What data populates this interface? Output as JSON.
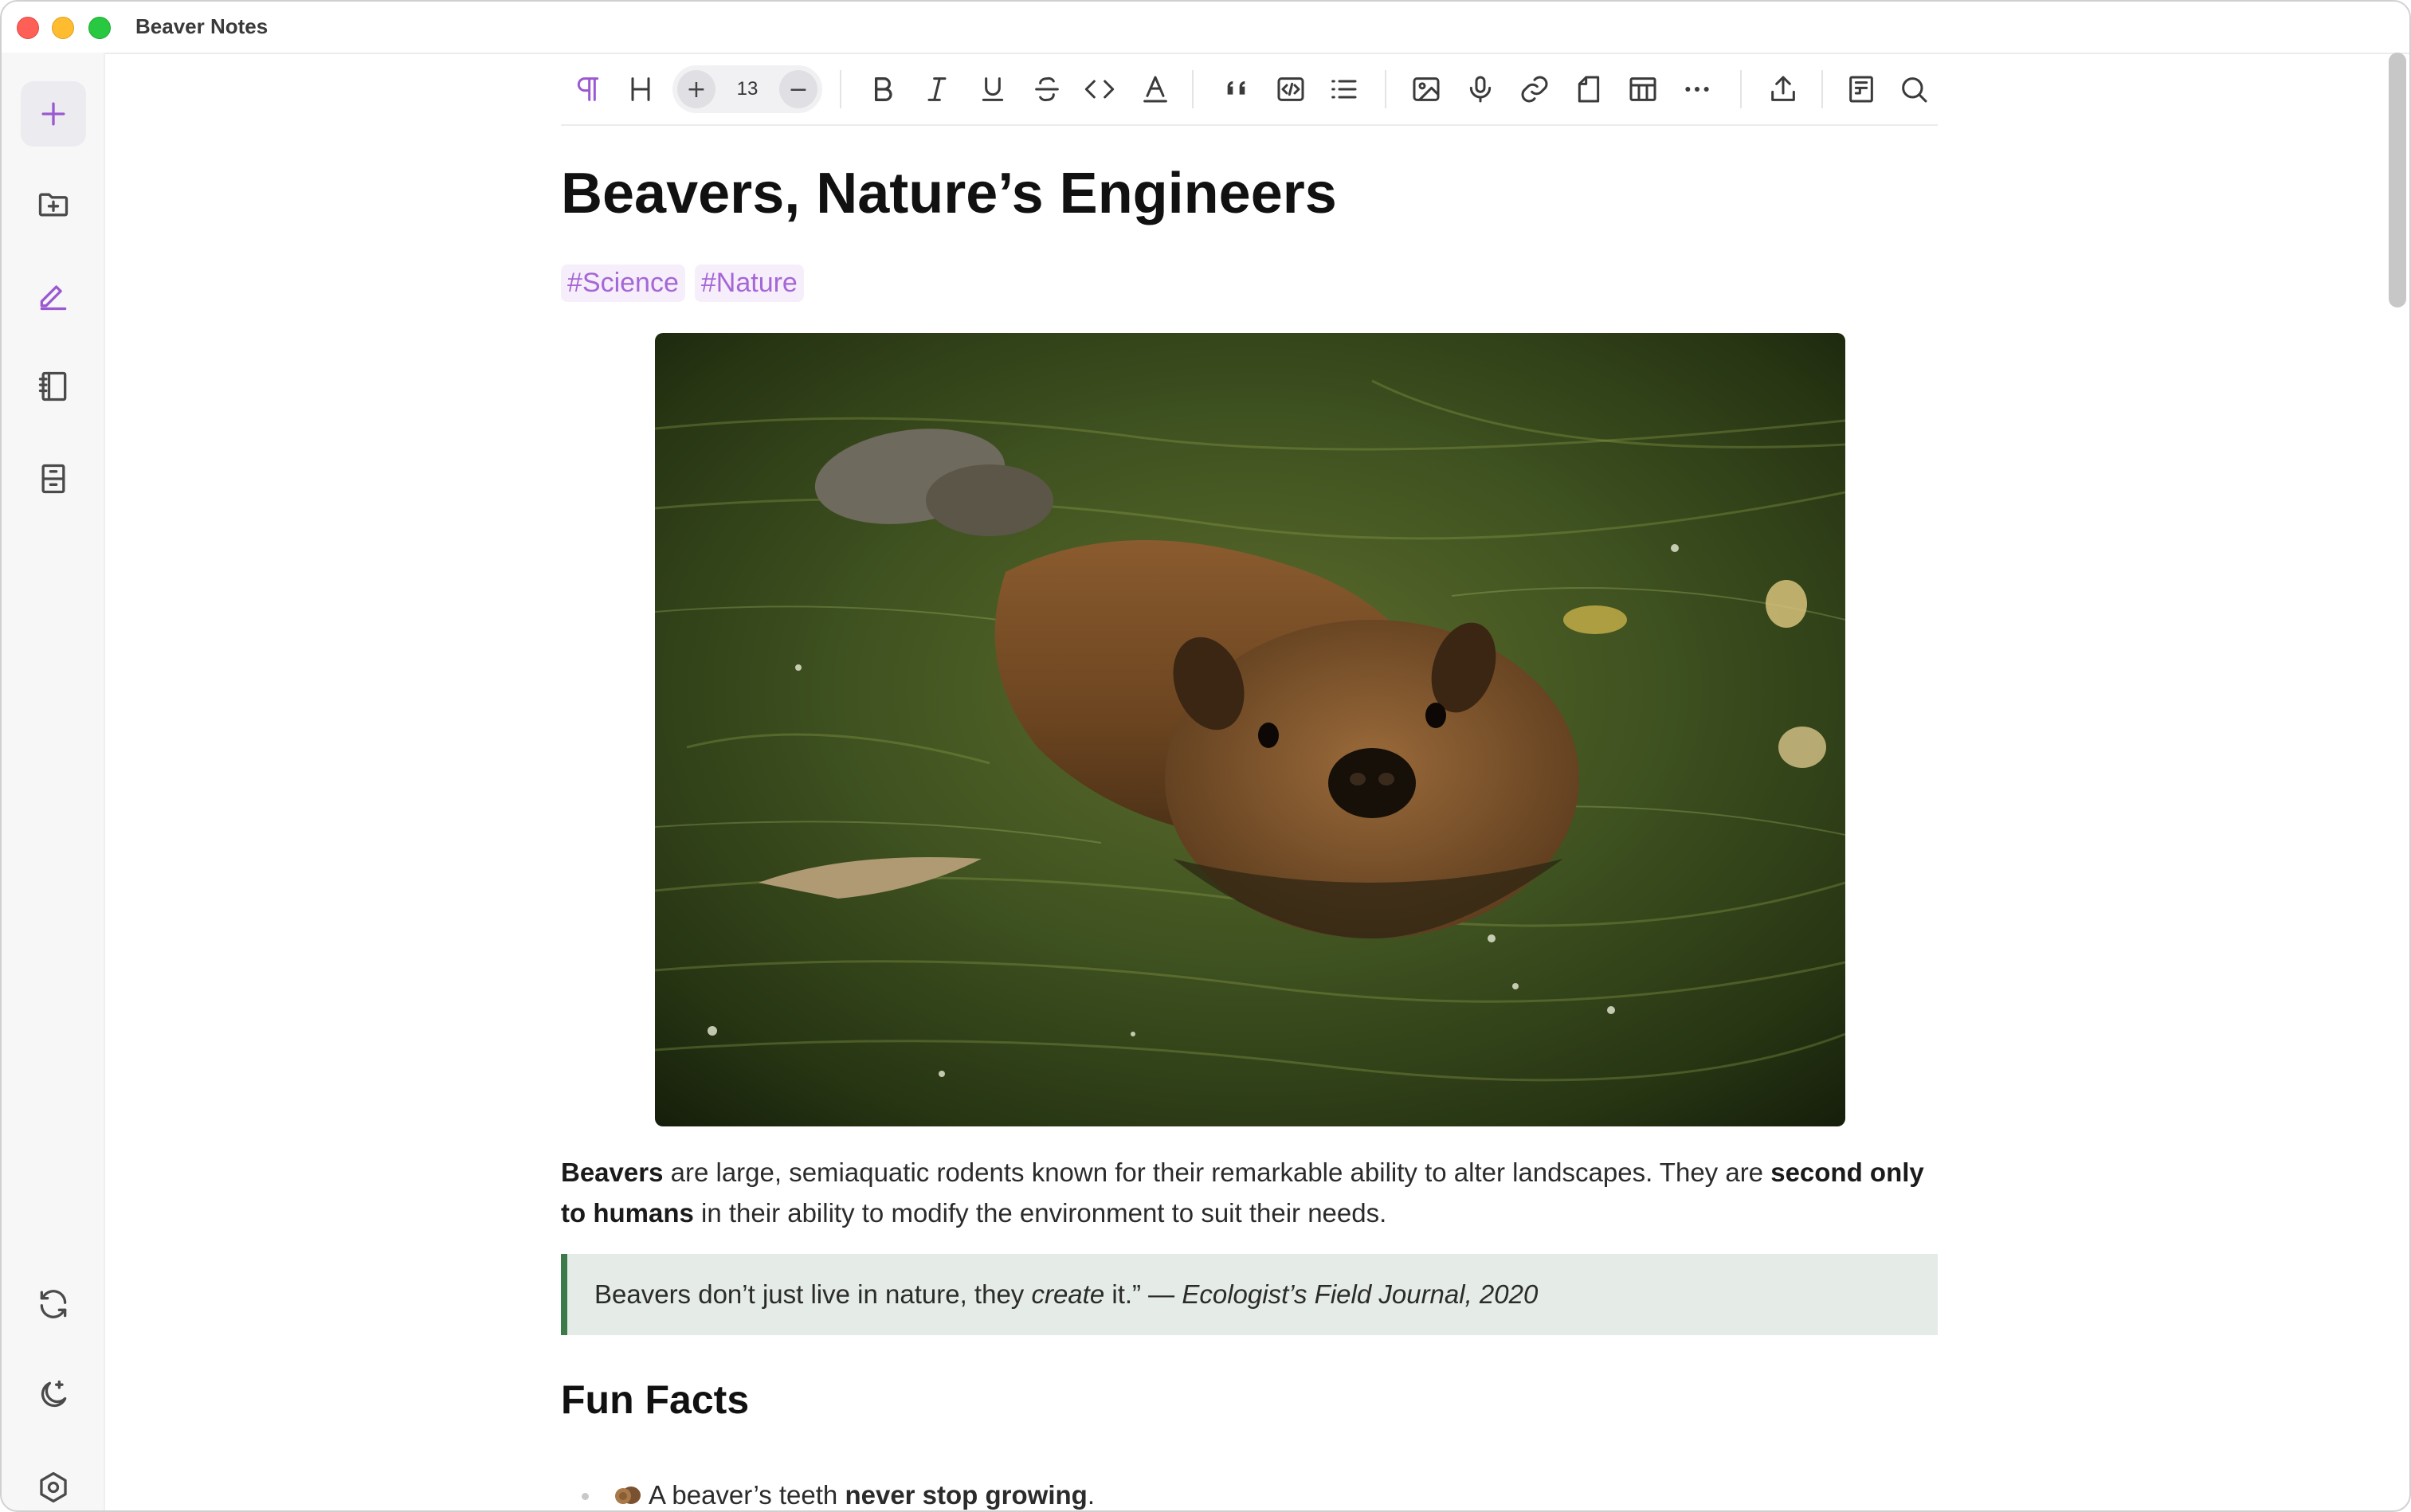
{
  "window": {
    "title": "Beaver Notes"
  },
  "sidebar": {
    "items": [
      {
        "name": "add-note",
        "icon": "plus-icon"
      },
      {
        "name": "new-folder",
        "icon": "folder-plus-icon"
      },
      {
        "name": "editor",
        "icon": "pencil-icon"
      },
      {
        "name": "notebooks",
        "icon": "notebook-icon"
      },
      {
        "name": "archive",
        "icon": "archive-icon"
      },
      {
        "name": "sync",
        "icon": "sync-icon"
      },
      {
        "name": "theme",
        "icon": "moon-icon"
      },
      {
        "name": "settings",
        "icon": "settings-icon"
      }
    ]
  },
  "toolbar": {
    "font_size": "13",
    "font_increase": "+",
    "font_decrease": "−"
  },
  "document": {
    "title": "Beavers, Nature’s Engineers",
    "tags": [
      "#Science",
      "#Nature"
    ],
    "paragraph": {
      "part1_bold": "Beavers",
      "part2": " are large, semiaquatic rodents known for their remarkable ability to alter landscapes. They are ",
      "part3_bold": "second only to humans",
      "part4": " in their ability to modify the environment to suit their needs."
    },
    "quote": {
      "part1": "Beavers don’t just live in nature, they ",
      "part2_italic": "create",
      "part3": " it.” — ",
      "part4_italic": "Ecologist’s Field Journal, 2020"
    },
    "section_heading": "Fun Facts",
    "facts": [
      {
        "text_before": "A beaver’s teeth ",
        "text_bold": "never stop growing",
        "text_after": "."
      }
    ]
  },
  "colors": {
    "accent": "#9b59d0",
    "tag_bg": "#f6eefb",
    "quote_bg": "#e5ebe6",
    "quote_border": "#3d7a4a"
  }
}
